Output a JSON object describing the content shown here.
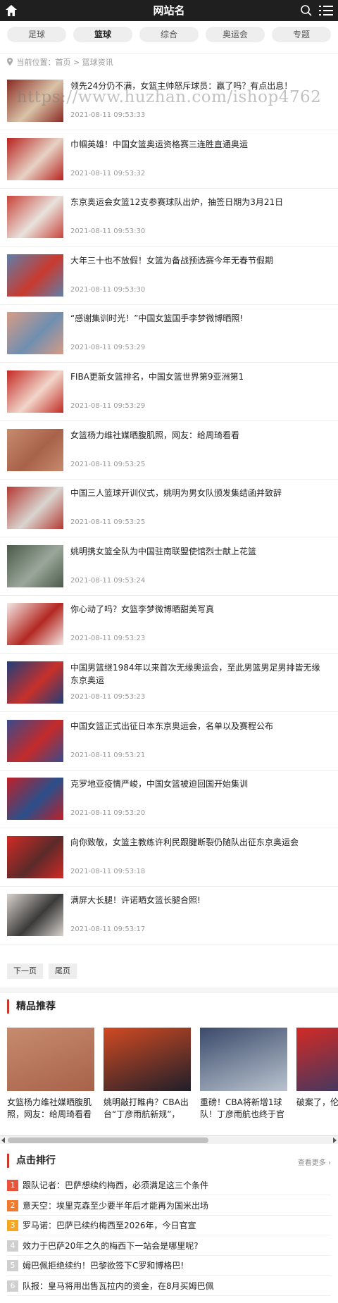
{
  "header": {
    "title": "网站名"
  },
  "nav": {
    "tabs": [
      "足球",
      "篮球",
      "综合",
      "奥运会",
      "专题"
    ],
    "active_index": 1
  },
  "breadcrumb": {
    "prefix": "当前位置：",
    "home": "首页",
    "sep": " > ",
    "current": "篮球资讯"
  },
  "watermark": "https://www.huzhan.com/ishop4762",
  "articles": [
    {
      "title": "领先24分仍不满，女篮主帅怒斥球员：赢了吗？有点出息！",
      "time": "2021-08-11 09:53:33",
      "colors": [
        "#8a2a22",
        "#d9c3a8"
      ]
    },
    {
      "title": "巾帼英雄！中国女篮奥运资格赛三连胜直通奥运",
      "time": "2021-08-11 09:53:32",
      "colors": [
        "#b8231f",
        "#e6d2c4"
      ]
    },
    {
      "title": "东京奥运会女篮12支参赛球队出炉，抽签日期为3月21日",
      "time": "2021-08-11 09:53:30",
      "colors": [
        "#c9433a",
        "#e8e2dc"
      ]
    },
    {
      "title": "大年三十也不放假！女篮为备战预选赛今年无春节假期",
      "time": "2021-08-11 09:53:30",
      "colors": [
        "#5f7fa9",
        "#c93a2e"
      ]
    },
    {
      "title": "“感谢集训时光！”中国女篮国手李梦微博晒照!",
      "time": "2021-08-11 09:53:29",
      "colors": [
        "#d89b86",
        "#6f8fb0"
      ]
    },
    {
      "title": "FIBA更新女篮排名，中国女篮世界第9亚洲第1",
      "time": "2021-08-11 09:53:29",
      "colors": [
        "#c32a24",
        "#f1d5c9"
      ]
    },
    {
      "title": "女篮杨力维社媒晒腹肌照，网友：给周琦看看",
      "time": "2021-08-11 09:53:25",
      "colors": [
        "#c68b6e",
        "#a8624a"
      ]
    },
    {
      "title": "中国三人篮球开训仪式，姚明为男女队颁发集结函并致辞",
      "time": "2021-08-11 09:53:25",
      "colors": [
        "#b43a33",
        "#d9d4cf"
      ]
    },
    {
      "title": "姚明携女篮全队为中国驻南联盟使馆烈士献上花篮",
      "time": "2021-08-11 09:53:24",
      "colors": [
        "#4b5a4a",
        "#9aa79a"
      ]
    },
    {
      "title": "你心动了吗？女篮李梦微博晒甜美写真",
      "time": "2021-08-11 09:53:23",
      "colors": [
        "#f2e8e4",
        "#b42822"
      ]
    },
    {
      "title": "中国男篮继1984年以来首次无缘奥运会，至此男篮男足男排皆无缘东京奥运",
      "time": "2021-08-11 09:53:23",
      "colors": [
        "#1f3f7a",
        "#c8302a"
      ]
    },
    {
      "title": "中国女篮正式出征日本东京奥运会，名单以及赛程公布",
      "time": "2021-08-11 09:53:21",
      "colors": [
        "#3a4b8a",
        "#c42a2a"
      ]
    },
    {
      "title": "克罗地亚疫情严峻，中国女篮被迫回国开始集训",
      "time": "2021-08-11 09:53:20",
      "colors": [
        "#c01f28",
        "#2a4f8a"
      ]
    },
    {
      "title": "向你致敬，女篮主教练许利民跟腱断裂仍随队出征东京奥运会",
      "time": "2021-08-11 09:53:18",
      "colors": [
        "#d12a25",
        "#5b2a2a"
      ]
    },
    {
      "title": "满屏大长腿！许诺晒女篮长腿合照!",
      "time": "2021-08-11 09:53:17",
      "colors": [
        "#d8d2cc",
        "#3a3a3a"
      ]
    }
  ],
  "pager": {
    "next": "下一页",
    "last": "尾页"
  },
  "featured": {
    "heading": "精品推荐",
    "cards": [
      {
        "title": "女篮杨力维社媒晒腹肌照，网友：给周琦看看",
        "colors": [
          "#c68b6e",
          "#a8624a"
        ]
      },
      {
        "title": "姚明敲打睢冉？CBA出台“丁彦雨航新规”，",
        "colors": [
          "#d14a22",
          "#1f1f2a"
        ]
      },
      {
        "title": "重磅！CBA将新增1球队！丁彦雨航也终于官",
        "colors": [
          "#3a4a6a",
          "#b9c3cf"
        ]
      },
      {
        "title": "破案了，伦、大王",
        "colors": [
          "#d22a25",
          "#2a3a6a"
        ]
      }
    ]
  },
  "ranking": {
    "heading": "点击排行",
    "more": "查看更多",
    "items": [
      {
        "num": "1",
        "title": "跟队记者：巴萨想续约梅西，必须满足这三个条件",
        "color": "#e8533b"
      },
      {
        "num": "2",
        "title": "意天空：埃里克森至少要半年后才能再为国米出场",
        "color": "#f07b2d"
      },
      {
        "num": "3",
        "title": "罗马诺：巴萨已续约梅西至2026年，今日官宣",
        "color": "#f5a623"
      },
      {
        "num": "4",
        "title": "效力于巴萨20年之久的梅西下一站会是哪里呢?",
        "color": "#cfcfcf"
      },
      {
        "num": "5",
        "title": "姆巴佩拒绝续约！巴黎欲签下C罗和博格巴!",
        "color": "#cfcfcf"
      },
      {
        "num": "6",
        "title": "队报：皇马将用出售瓦拉内的资金，在8月买姆巴佩",
        "color": "#cfcfcf"
      }
    ]
  }
}
